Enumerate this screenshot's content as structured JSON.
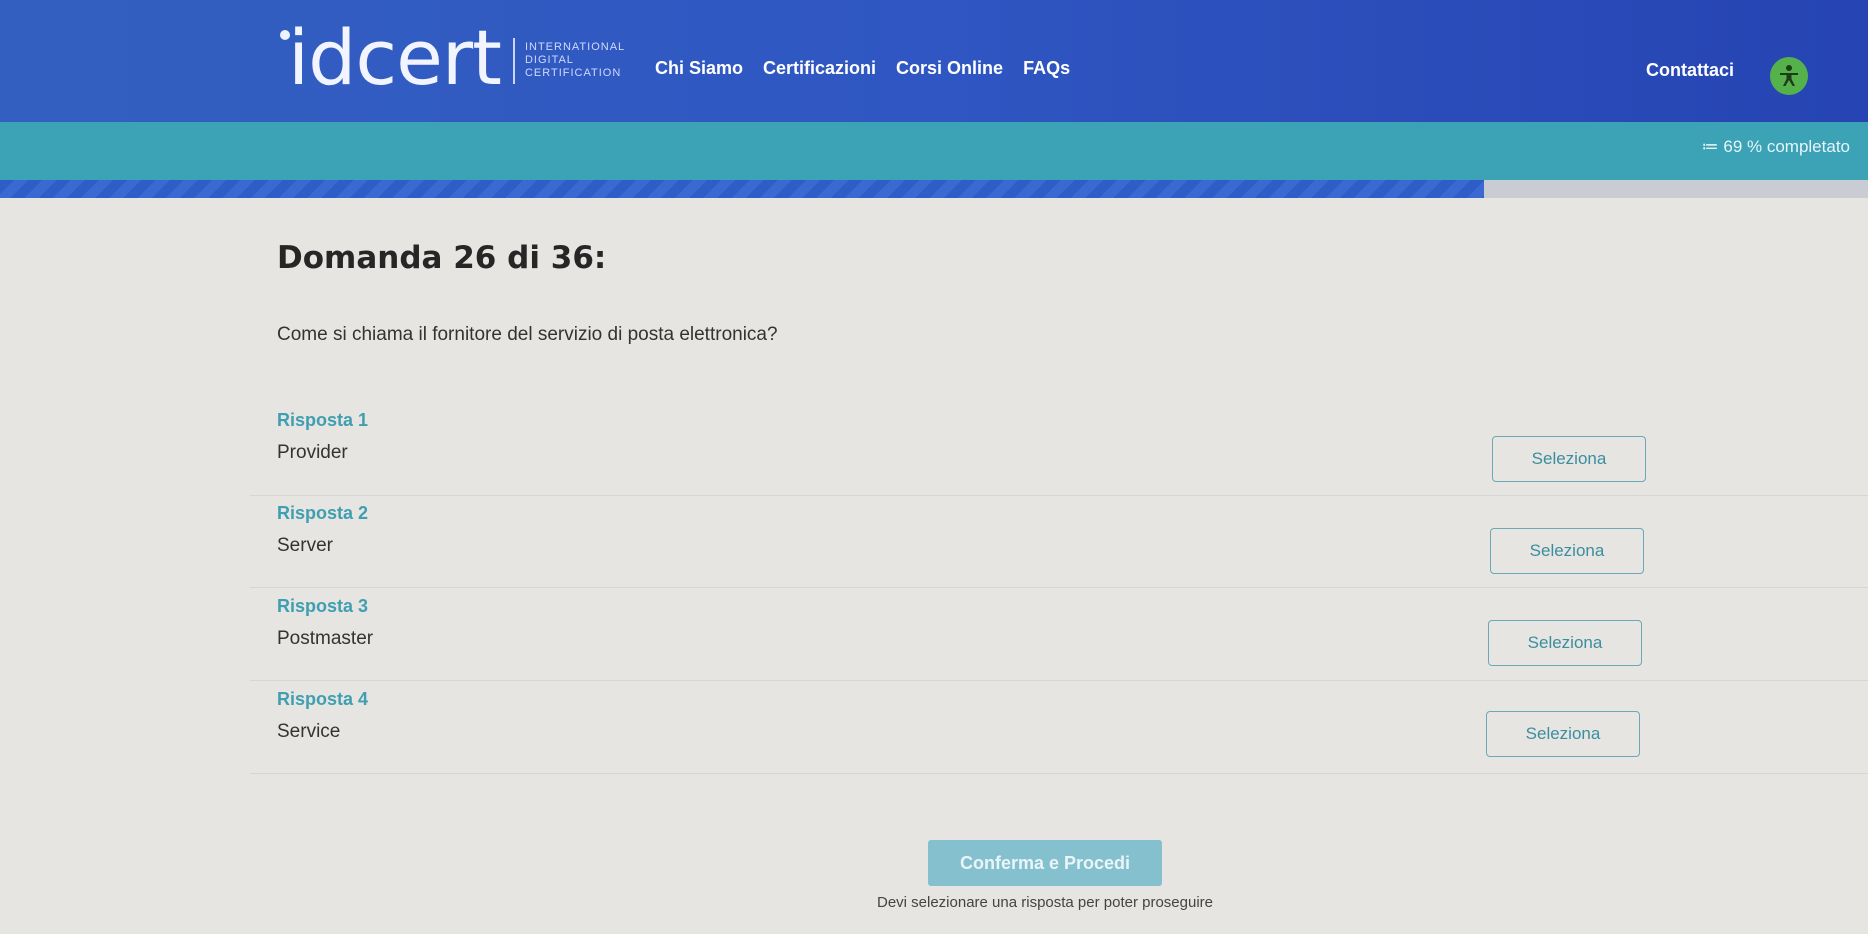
{
  "header": {
    "logo_text": "idcert",
    "logo_sub": [
      "INTERNATIONAL",
      "DIGITAL",
      "CERTIFICATION"
    ],
    "nav": [
      "Chi Siamo",
      "Certificazioni",
      "Corsi Online",
      "FAQs"
    ],
    "contact": "Contattaci",
    "colors": {
      "header": "#2f56c2",
      "progress_band": "#3ca2b5",
      "accent": "#3f9fb1",
      "accessibility": "#55b24a"
    }
  },
  "progress": {
    "label": "≔ 69 % completato",
    "percent": 69
  },
  "question": {
    "title": "Domanda 26 di 36:",
    "text": "Come si chiama il fornitore del servizio di posta elettronica?"
  },
  "answers": [
    {
      "label": "Risposta 1",
      "value": "Provider",
      "button": "Seleziona"
    },
    {
      "label": "Risposta 2",
      "value": "Server",
      "button": "Seleziona"
    },
    {
      "label": "Risposta 3",
      "value": "Postmaster",
      "button": "Seleziona"
    },
    {
      "label": "Risposta 4",
      "value": "Service",
      "button": "Seleziona"
    }
  ],
  "confirm": {
    "label": "Conferma e Procedi",
    "hint": "Devi selezionare una risposta per poter proseguire"
  }
}
